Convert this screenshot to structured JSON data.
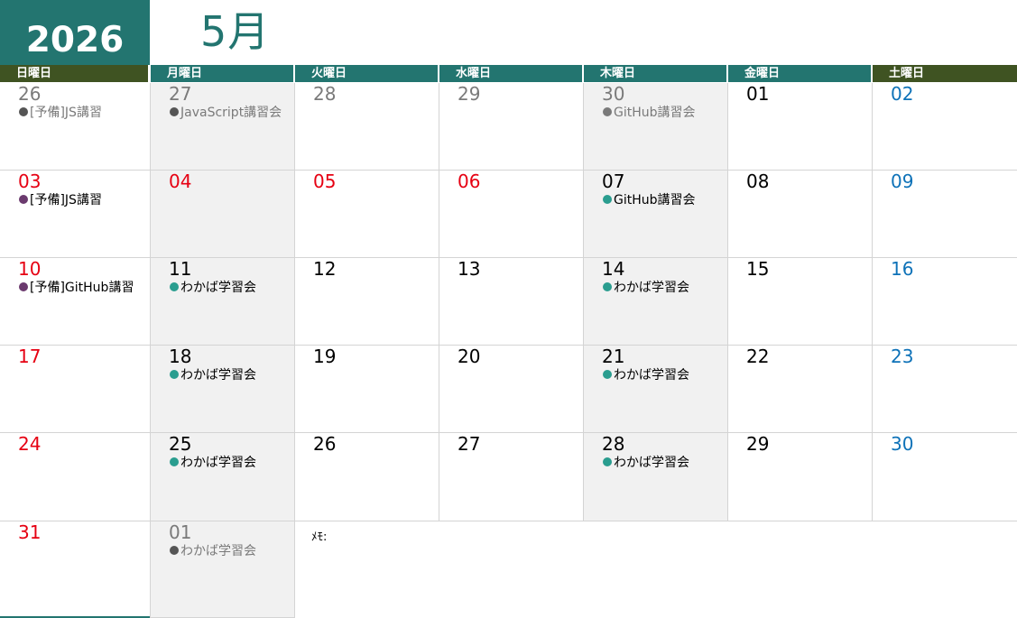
{
  "header": {
    "year": "2026",
    "month": "5月"
  },
  "colors": {
    "accent_teal": "#237570",
    "weekend_header_olive": "#3f5322",
    "sunday_red": "#e60012",
    "saturday_blue": "#0e72b8",
    "other_month_gray": "#7a7a7a",
    "alt_cell_bg": "#f1f1f1",
    "dot_gray": "#555555",
    "dot_purple": "#6b3a6e",
    "dot_teal": "#2a9d8f"
  },
  "weekdays": [
    {
      "label": "日曜日",
      "color": "#3f5322"
    },
    {
      "label": "月曜日",
      "color": "#237570"
    },
    {
      "label": "火曜日",
      "color": "#237570"
    },
    {
      "label": "水曜日",
      "color": "#237570"
    },
    {
      "label": "木曜日",
      "color": "#237570"
    },
    {
      "label": "金曜日",
      "color": "#237570"
    },
    {
      "label": "土曜日",
      "color": "#3f5322"
    }
  ],
  "weeks": [
    [
      {
        "day": "26",
        "kind": "other",
        "event": "[予備]JS講習",
        "dot": "#555555"
      },
      {
        "day": "27",
        "kind": "other",
        "event": "JavaScript講習会",
        "dot": "#555555"
      },
      {
        "day": "28",
        "kind": "other"
      },
      {
        "day": "29",
        "kind": "other"
      },
      {
        "day": "30",
        "kind": "other",
        "event": "GitHub講習会",
        "dot": "#7a7a7a"
      },
      {
        "day": "01",
        "kind": "normal"
      },
      {
        "day": "02",
        "kind": "sat"
      }
    ],
    [
      {
        "day": "03",
        "kind": "sun",
        "event": "[予備]JS講習",
        "dot": "#6b3a6e"
      },
      {
        "day": "04",
        "kind": "sun"
      },
      {
        "day": "05",
        "kind": "sun"
      },
      {
        "day": "06",
        "kind": "sun"
      },
      {
        "day": "07",
        "kind": "normal",
        "event": "GitHub講習会",
        "dot": "#2a9d8f"
      },
      {
        "day": "08",
        "kind": "normal"
      },
      {
        "day": "09",
        "kind": "sat"
      }
    ],
    [
      {
        "day": "10",
        "kind": "sun",
        "event": "[予備]GitHub講習",
        "dot": "#6b3a6e"
      },
      {
        "day": "11",
        "kind": "normal",
        "event": "わかば学習会",
        "dot": "#2a9d8f"
      },
      {
        "day": "12",
        "kind": "normal"
      },
      {
        "day": "13",
        "kind": "normal"
      },
      {
        "day": "14",
        "kind": "normal",
        "event": "わかば学習会",
        "dot": "#2a9d8f"
      },
      {
        "day": "15",
        "kind": "normal"
      },
      {
        "day": "16",
        "kind": "sat"
      }
    ],
    [
      {
        "day": "17",
        "kind": "sun"
      },
      {
        "day": "18",
        "kind": "normal",
        "event": "わかば学習会",
        "dot": "#2a9d8f"
      },
      {
        "day": "19",
        "kind": "normal"
      },
      {
        "day": "20",
        "kind": "normal"
      },
      {
        "day": "21",
        "kind": "normal",
        "event": "わかば学習会",
        "dot": "#2a9d8f"
      },
      {
        "day": "22",
        "kind": "normal"
      },
      {
        "day": "23",
        "kind": "sat"
      }
    ],
    [
      {
        "day": "24",
        "kind": "sun"
      },
      {
        "day": "25",
        "kind": "normal",
        "event": "わかば学習会",
        "dot": "#2a9d8f"
      },
      {
        "day": "26",
        "kind": "normal"
      },
      {
        "day": "27",
        "kind": "normal"
      },
      {
        "day": "28",
        "kind": "normal",
        "event": "わかば学習会",
        "dot": "#2a9d8f"
      },
      {
        "day": "29",
        "kind": "normal"
      },
      {
        "day": "30",
        "kind": "sat"
      }
    ],
    [
      {
        "day": "31",
        "kind": "sun"
      },
      {
        "day": "01",
        "kind": "other",
        "event": "わかば学習会",
        "dot": "#555555"
      }
    ]
  ],
  "memo": {
    "label": "ﾒﾓ:"
  }
}
